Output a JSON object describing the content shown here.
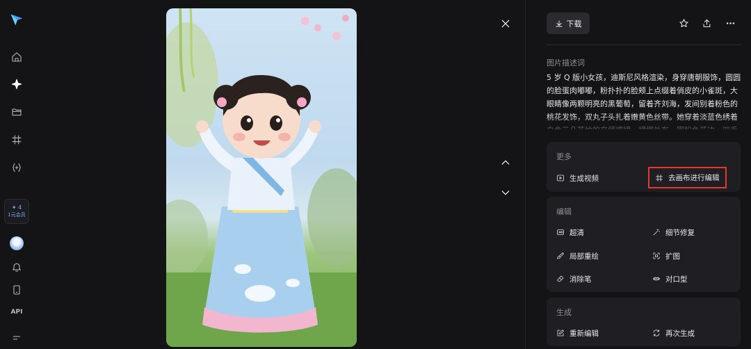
{
  "rail": {
    "api_label": "API",
    "vip_count": "✦ 4",
    "vip_label": "1元会员"
  },
  "toolbar": {
    "download_label": "下载"
  },
  "description": {
    "title": "图片描述词",
    "text": "5 岁 Q 版小女孩，迪斯尼风格渲染，身穿唐朝服饰，圆圆的脸蛋肉嘟嘟，粉扑扑的脸颊上点缀着俏皮的小雀斑，大眼睛像两颗明亮的黑葡萄，留着齐刘海，发间别着粉色的桃花发饰，双丸子头扎着嫩黄色丝带。她穿着淡蓝色绣着白色云朵花纹的交领襦裙，裙摆处有一圈粉色花边，双手举过头顶。"
  },
  "more": {
    "title": "更多",
    "generate_video": "生成视频",
    "canvas_edit": "去画布进行编辑"
  },
  "edit": {
    "title": "编辑",
    "hd": "超清",
    "detail_repair": "细节修复",
    "partial_redraw": "局部重绘",
    "expand": "扩图",
    "eraser": "消除笔",
    "lip_sync": "对口型"
  },
  "generate": {
    "title": "生成",
    "re_edit": "重新编辑",
    "regenerate": "再次生成"
  },
  "icons": {
    "logo": "paper-plane-logo",
    "home": "home-icon",
    "explore": "sparkle-icon",
    "folder": "folder-icon",
    "canvas": "hash-icon",
    "code": "braces-icon",
    "bell": "bell-icon",
    "phone": "phone-icon",
    "menu": "menu-icon"
  },
  "colors": {
    "background": "#141416",
    "card": "#1f1f23",
    "highlight": "#e23b2e",
    "accent": "#7aa7ff"
  }
}
